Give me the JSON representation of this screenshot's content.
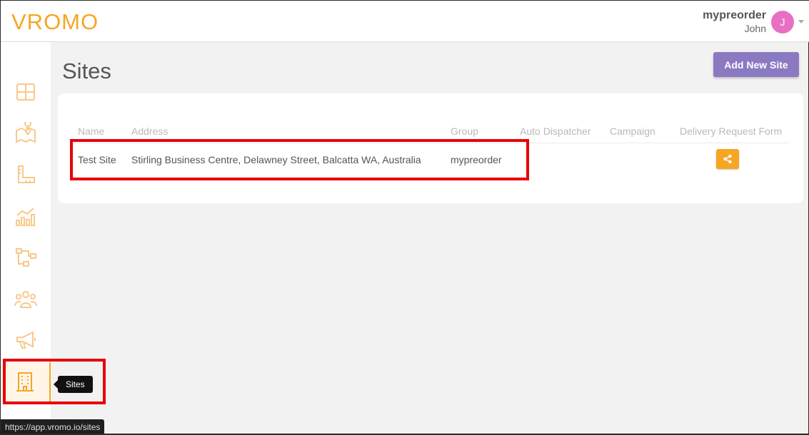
{
  "header": {
    "logo": "VROMO",
    "user_org": "mypreorder",
    "user_name": "John",
    "avatar_initial": "J"
  },
  "sidebar": {
    "items": [
      {
        "icon": "dashboard-icon"
      },
      {
        "icon": "map-icon"
      },
      {
        "icon": "ruler-icon"
      },
      {
        "icon": "analytics-icon"
      },
      {
        "icon": "workflow-icon"
      },
      {
        "icon": "users-icon"
      },
      {
        "icon": "megaphone-icon"
      },
      {
        "icon": "building-icon",
        "active": true
      }
    ],
    "tooltip": "Sites"
  },
  "page": {
    "title": "Sites",
    "add_button": "Add New Site"
  },
  "table": {
    "columns": [
      "Name",
      "Address",
      "Group",
      "Auto Dispatcher",
      "Campaign",
      "Delivery Request Form"
    ],
    "rows": [
      {
        "name": "Test Site",
        "address": "Stirling Business Centre, Delawney Street, Balcatta WA, Australia",
        "group": "mypreorder",
        "auto_dispatcher": "",
        "campaign": "",
        "delivery_request_form_icon": "share-icon"
      }
    ]
  },
  "status_bar": {
    "url": "https://app.vromo.io/sites"
  },
  "colors": {
    "accent": "#f6a623",
    "primary_button": "#8b7ac2",
    "avatar": "#e96fc2",
    "highlight": "#e8000b"
  }
}
